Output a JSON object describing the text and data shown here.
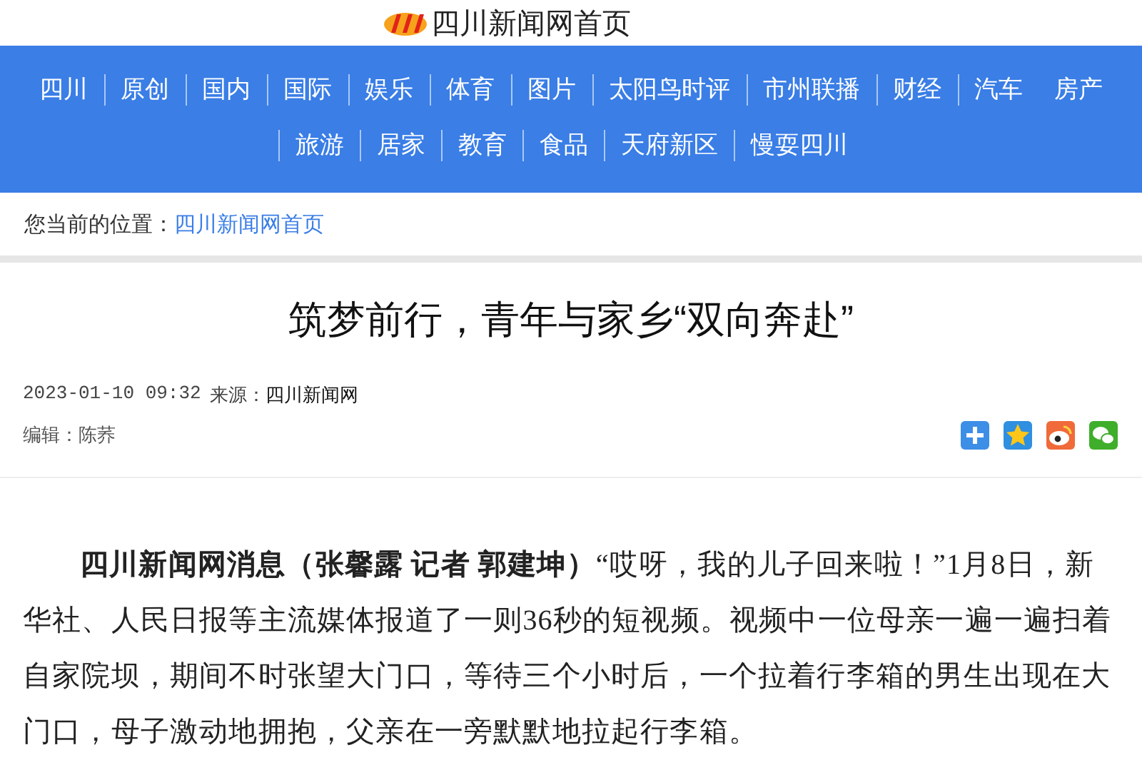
{
  "header": {
    "site_name": "四川新闻网首页"
  },
  "nav": {
    "items": [
      "四川",
      "原创",
      "国内",
      "国际",
      "娱乐",
      "体育",
      "图片",
      "太阳鸟时评",
      "市州联播",
      "财经",
      "汽车",
      "房产",
      "旅游",
      "居家",
      "教育",
      "食品",
      "天府新区",
      "慢耍四川"
    ]
  },
  "breadcrumb": {
    "label": "您当前的位置：",
    "link": "四川新闻网首页"
  },
  "article": {
    "title": "筑梦前行，青年与家乡“双向奔赴”",
    "datetime": "2023-01-10 09:32",
    "source_label": "来源：",
    "source": "四川新闻网",
    "editor": "编辑：陈荞",
    "share": [
      {
        "kind": "plus"
      },
      {
        "kind": "qzone"
      },
      {
        "kind": "weibo"
      },
      {
        "kind": "wechat"
      }
    ],
    "body": "**四川新闻网消息（张馨露 记者 郭建坤）**“哎呀，我的儿子回来啦！”1月8日，新华社、人民日报等主流媒体报道了一则36秒的短视频。视频中一位母亲一遍一遍扫着自家院坝，期间不时张望大门口，等待三个小时后，一个拉着行李箱的男生出现在大门口，母子激动地拥抱，父亲在一旁默默地拉起行李箱。"
  }
}
